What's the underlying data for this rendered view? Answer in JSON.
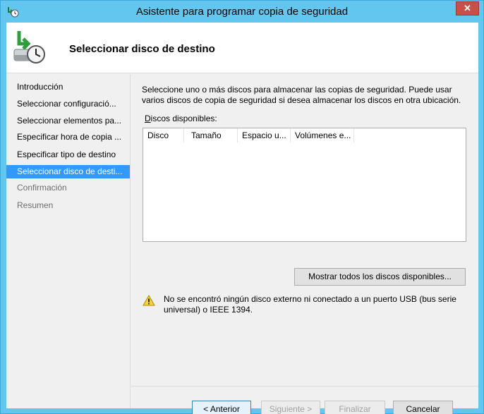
{
  "window": {
    "title": "Asistente para programar copia de seguridad",
    "close_glyph": "✕"
  },
  "header": {
    "title": "Seleccionar disco de destino",
    "icon": "backup-disk-clock-icon"
  },
  "sidebar": {
    "items": [
      {
        "label": "Introducción",
        "state": "normal"
      },
      {
        "label": "Seleccionar configuració...",
        "state": "normal"
      },
      {
        "label": "Seleccionar elementos pa...",
        "state": "normal"
      },
      {
        "label": "Especificar hora de copia ...",
        "state": "normal"
      },
      {
        "label": "Especificar tipo de destino",
        "state": "normal"
      },
      {
        "label": "Seleccionar disco de desti...",
        "state": "active"
      },
      {
        "label": "Confirmación",
        "state": "disabled"
      },
      {
        "label": "Resumen",
        "state": "disabled"
      }
    ]
  },
  "main": {
    "instructions": "Seleccione uno o más discos para almacenar las copias de seguridad. Puede usar varios discos de copia de seguridad si desea almacenar los discos en otra ubicación.",
    "list_label_accel": "D",
    "list_label_rest": "iscos disponibles:",
    "columns": [
      "Disco",
      "Tamaño",
      "Espacio u...",
      "Volúmenes e..."
    ],
    "show_all_button": "Mostrar todos los discos disponibles...",
    "warning": "No se encontró ningún disco externo ni conectado a un puerto USB (bus serie universal) o IEEE 1394."
  },
  "buttons": {
    "back": "< Anterior",
    "next": "Siguiente >",
    "finish": "Finalizar",
    "cancel": "Cancelar"
  },
  "colors": {
    "accent": "#3399ff",
    "titlebar": "#62c6ef",
    "close": "#c7504a"
  }
}
